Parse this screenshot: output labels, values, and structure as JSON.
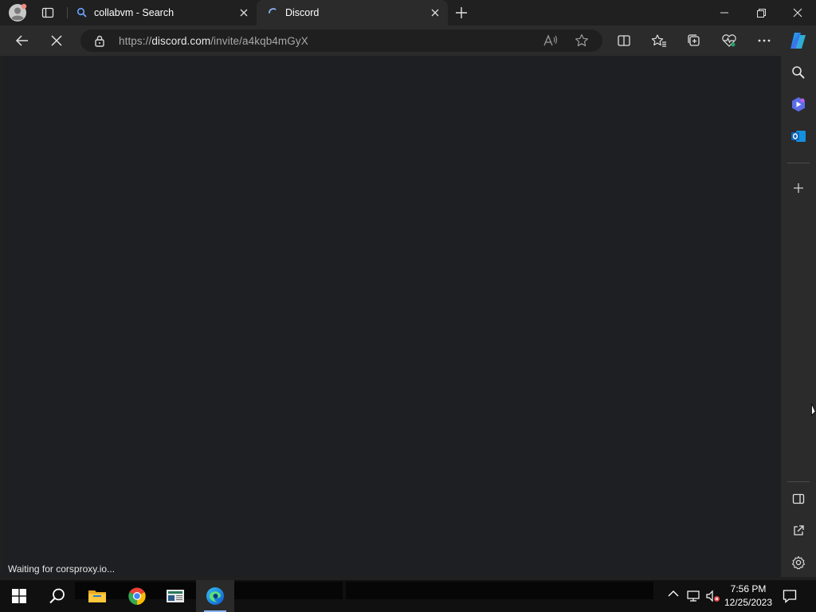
{
  "browser": {
    "tabs": [
      {
        "title": "collabvm - Search",
        "icon": "search-icon",
        "active": false
      },
      {
        "title": "Discord",
        "icon": "loading-spinner-icon",
        "active": true
      }
    ],
    "address": {
      "prefix": "https://",
      "host": "discord.com",
      "path": "/invite/a4kqb4mGyX"
    },
    "status_text": "Waiting for corsproxy.io..."
  },
  "sidebar": {
    "icons": [
      "search-icon",
      "copilot-icon",
      "outlook-icon",
      "add-icon",
      "hide-sidebar-icon",
      "open-external-icon",
      "settings-icon"
    ]
  },
  "taskbar": {
    "apps": [
      "start-icon",
      "search-icon",
      "file-explorer-icon",
      "chrome-icon",
      "news-icon",
      "edge-icon"
    ],
    "time": "7:56 PM",
    "date": "12/25/2023"
  },
  "colors": {
    "content_bg": "#1e1f22",
    "chrome_bg": "#2b2b2b",
    "taskbar_bg": "#101010",
    "accent": "#8ab4f8"
  }
}
